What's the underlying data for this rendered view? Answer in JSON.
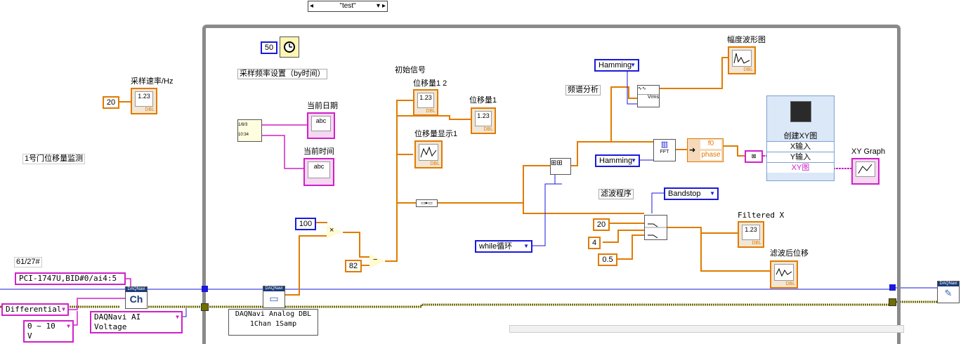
{
  "case_selector": {
    "label": "\"test\""
  },
  "labels": {
    "sample_rate": "采样速率/Hz",
    "monitor": "1号门位移量监测",
    "counter": "61/27#",
    "sample_freq_setting": "采样频率设置（by时间）",
    "current_date": "当前日期",
    "current_time": "当前时间",
    "initial_signal": "初始信号",
    "displacement_12": "位移量1 2",
    "displacement_1": "位移量1",
    "displacement_display_1": "位移量显示1",
    "amplitude_waveform": "幅度波形图",
    "spectrum_analysis": "频谱分析",
    "build_xy": "创建XY图",
    "xy_graph": "XY Graph",
    "filter_program": "滤波程序",
    "filtered_x": "Filtered X",
    "filtered_displacement": "滤波后位移",
    "x_input": "X输入",
    "y_input": "Y输入",
    "xy_out": "XY图"
  },
  "constants": {
    "sample_rate_value": "20",
    "wait_ms": "50",
    "multiplier": "100",
    "offset": "82",
    "filter_order": "20",
    "filter_low": "4",
    "filter_high": "0.5"
  },
  "controls": {
    "channel": "PCI-1747U,BID#0/ai4:5",
    "terminal_config": "Differential",
    "range": "0 ~ 10 V",
    "ai_type": "DAQNavi AI Voltage",
    "read_mode_1": "DAQNavi Analog DBL",
    "read_mode_2": "1Chan 1Samp",
    "window_1": "Hamming",
    "window_2": "Hamming",
    "filter_type": "Bandstop",
    "while_loop": "while循环"
  },
  "nodes": {
    "f0": "f0",
    "phase": "phase",
    "fft": "FFT",
    "vrms": "Vrms",
    "dbl": "DBL",
    "abc": "abc",
    "num": "1.23",
    "daqnavi": "DAQNavi",
    "ch": "Ch"
  },
  "colors": {
    "numeric_wire": "#e07b00",
    "string_wire": "#d020c8",
    "enum_wire": "#1a1adb",
    "error_wire": "#6f6d00",
    "frame": "#8a8a8a"
  }
}
